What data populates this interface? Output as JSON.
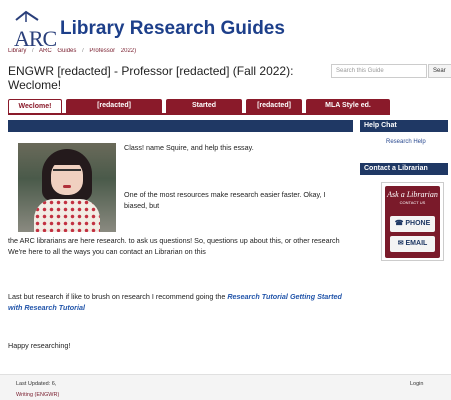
{
  "header": {
    "logo_text": "ARC",
    "site_title": "Library Research Guides"
  },
  "breadcrumb": {
    "items": [
      "Library",
      "ARC",
      "Guides",
      "Professor",
      "2022)"
    ]
  },
  "page": {
    "title": "ENGWR [redacted] - Professor [redacted] (Fall 2022): Weclome!",
    "search_placeholder": "Search this Guide",
    "search_button": "Sear"
  },
  "tabs": [
    {
      "label": "Weclome!",
      "active": true
    },
    {
      "label": "[redacted]",
      "active": false
    },
    {
      "label": "Started",
      "active": false
    },
    {
      "label": "[redacted]",
      "active": false
    },
    {
      "label": "MLA Style ed.",
      "active": false
    }
  ],
  "sidebar": {
    "chat_heading": "Help Chat",
    "research_help_label": "Research Help",
    "contact_heading": "Contact a Librarian",
    "ask_title": "Ask a Librarian",
    "ask_sub": "CONTACT US",
    "phone_label": "PHONE",
    "email_label": "EMAIL"
  },
  "content": {
    "p1": "Class! name Squire, and help this essay.",
    "p2": "One of the most resources make research easier faster. Okay, I biased, but",
    "p3": "the ARC librarians are here research. to ask us questions! So, questions up about this, or other research We're here to all the ways you can contact an Librarian on this",
    "p4_start": "Last but research if like to brush on research I recommend going the",
    "p4_link1": "Research Tutorial",
    "p4_link2": "Getting Started with Research Tutorial",
    "p5": "Happy researching!"
  },
  "footer": {
    "updated": "Last Updated: 6,",
    "login": "Login",
    "subjects": "Writing (ENGWR)"
  }
}
